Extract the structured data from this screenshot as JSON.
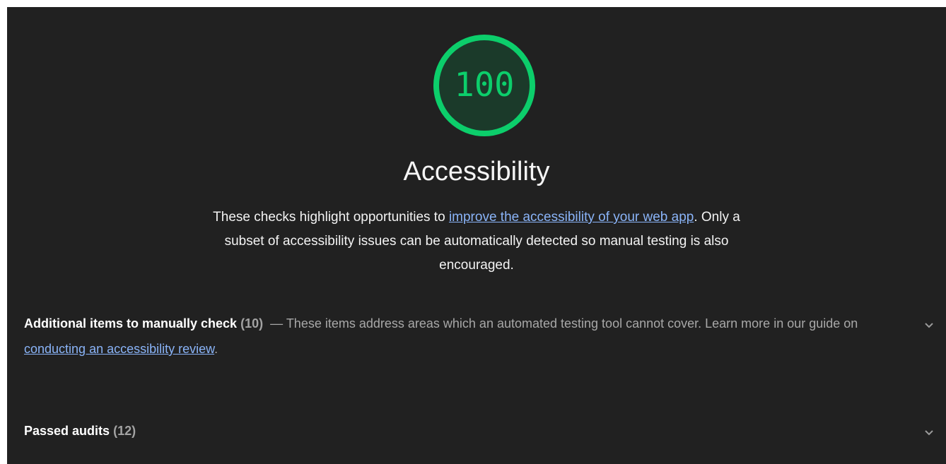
{
  "score": {
    "value": "100",
    "fraction": 1.0,
    "color": "#0cce6b"
  },
  "category": {
    "title": "Accessibility",
    "description_before": "These checks highlight opportunities to ",
    "description_link": "improve the accessibility of your web app",
    "description_after": ". Only a subset of accessibility issues can be automatically detected so manual testing is also encouraged."
  },
  "groups": {
    "manual": {
      "title": "Additional items to manually check",
      "count": "(10)",
      "separator": "—",
      "description_before": "These items address areas which an automated testing tool cannot cover. Learn more in our guide on ",
      "description_link": "conducting an accessibility review",
      "description_after": ".",
      "icon": "chevron-down-icon"
    },
    "passed": {
      "title": "Passed audits",
      "count": "(12)",
      "icon": "chevron-down-icon"
    }
  },
  "colors": {
    "background": "#212121",
    "link": "#8ab4f8",
    "pass": "#0cce6b"
  }
}
